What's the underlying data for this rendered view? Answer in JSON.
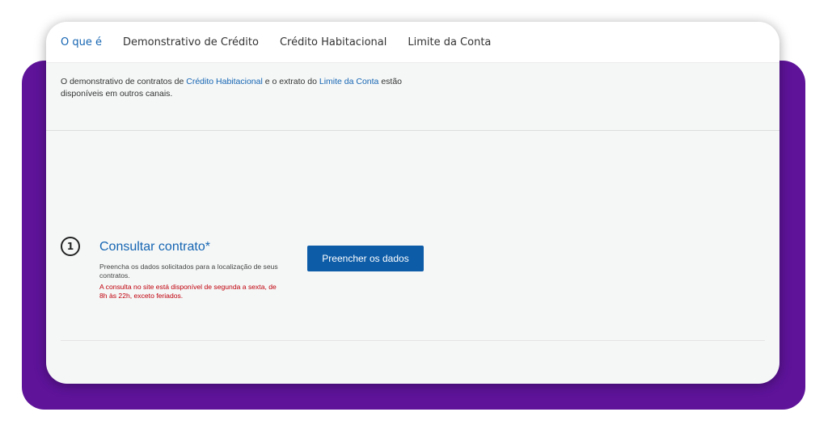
{
  "tabs": [
    {
      "label": "O que é",
      "active": true
    },
    {
      "label": "Demonstrativo de Crédito"
    },
    {
      "label": "Crédito Habitacional"
    },
    {
      "label": "Limite da Conta"
    }
  ],
  "intro": {
    "part1": "O demonstrativo de contratos de ",
    "link1": "Crédito Habitacional",
    "part2": " e o extrato do ",
    "link2": "Limite da Conta",
    "part3": " estão disponíveis em outros canais."
  },
  "step": {
    "number": "1",
    "title": "Consultar contrato*",
    "description": "Preencha os dados solicitados para a localização de seus contratos.",
    "warning": "A consulta no site está disponível de segunda a sexta, de 8h às 22h, exceto feriados.",
    "button_label": "Preencher os dados"
  },
  "colors": {
    "accent": "#1565b2",
    "button": "#0c5ca8",
    "warning": "#c0000b",
    "frame": "#5e1399"
  }
}
